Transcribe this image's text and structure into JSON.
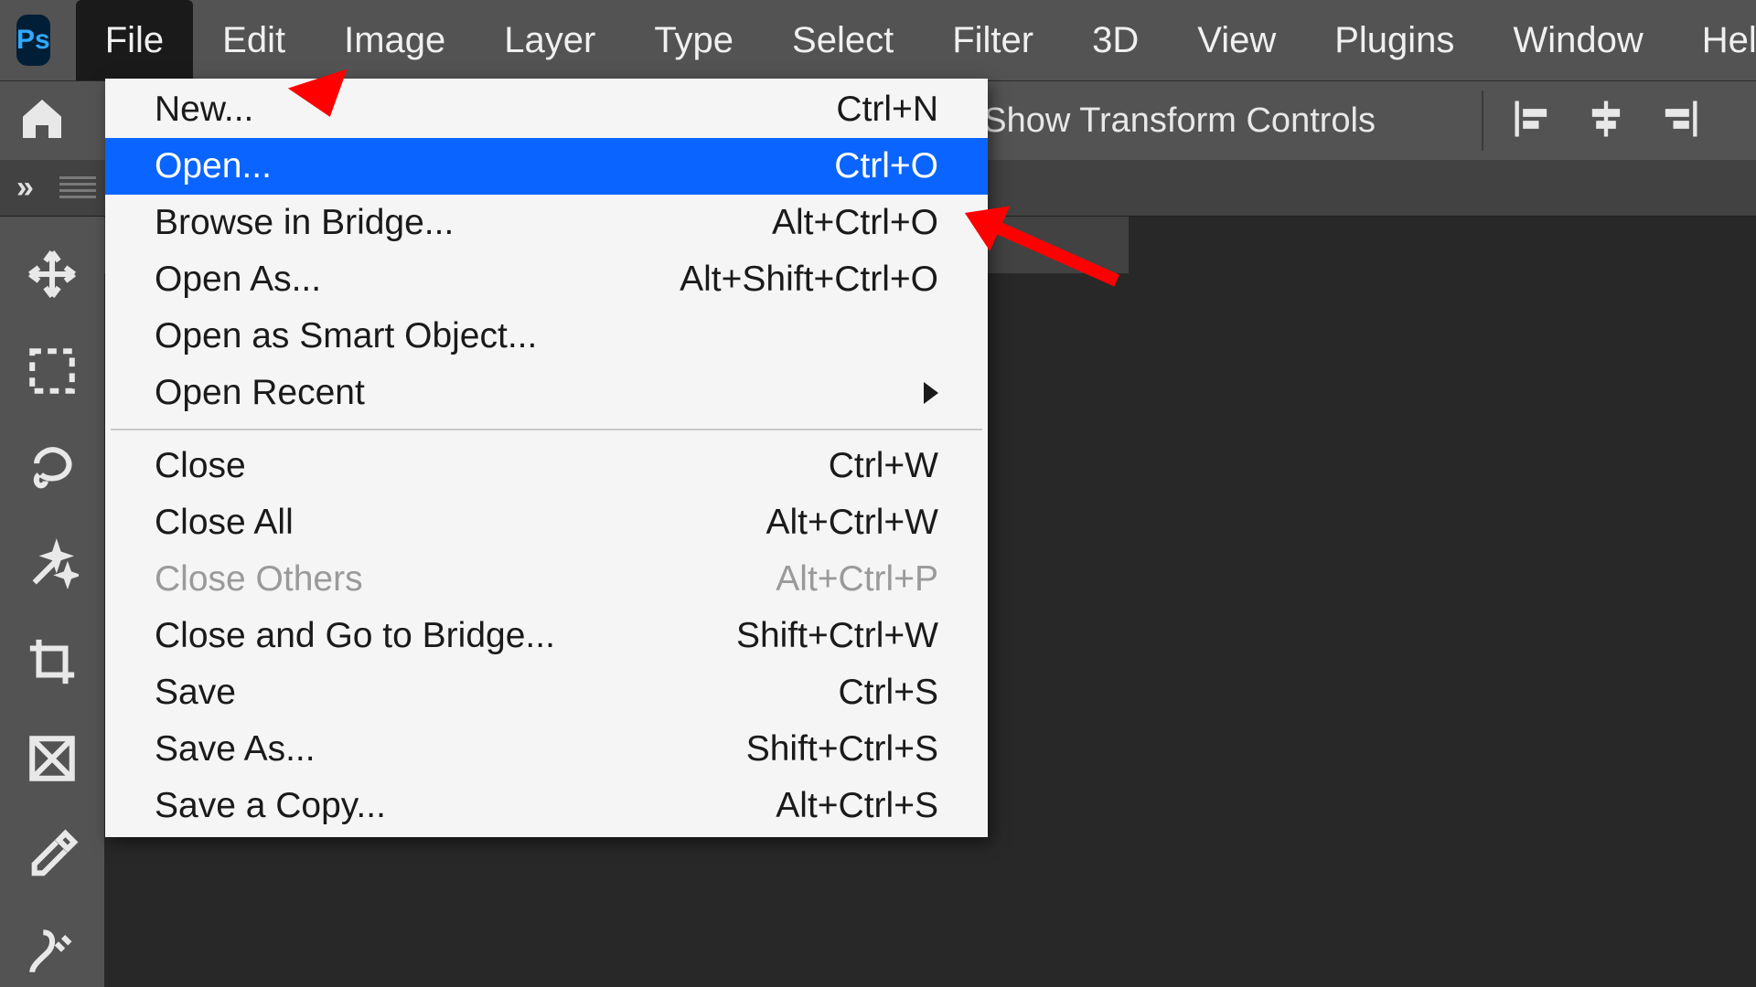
{
  "app": {
    "logo_text": "Ps"
  },
  "menubar": {
    "items": [
      "File",
      "Edit",
      "Image",
      "Layer",
      "Type",
      "Select",
      "Filter",
      "3D",
      "View",
      "Plugins",
      "Window",
      "Help"
    ],
    "open_index": 0
  },
  "optionsbar": {
    "transform_label": "Show Transform Controls"
  },
  "dropdown": {
    "items": [
      {
        "label": "New...",
        "shortcut": "Ctrl+N"
      },
      {
        "label": "Open...",
        "shortcut": "Ctrl+O",
        "highlight": true
      },
      {
        "label": "Browse in Bridge...",
        "shortcut": "Alt+Ctrl+O"
      },
      {
        "label": "Open As...",
        "shortcut": "Alt+Shift+Ctrl+O"
      },
      {
        "label": "Open as Smart Object...",
        "shortcut": ""
      },
      {
        "label": "Open Recent",
        "shortcut": "",
        "submenu": true
      },
      {
        "sep": true
      },
      {
        "label": "Close",
        "shortcut": "Ctrl+W"
      },
      {
        "label": "Close All",
        "shortcut": "Alt+Ctrl+W"
      },
      {
        "label": "Close Others",
        "shortcut": "Alt+Ctrl+P",
        "disabled": true
      },
      {
        "label": "Close and Go to Bridge...",
        "shortcut": "Shift+Ctrl+W"
      },
      {
        "label": "Save",
        "shortcut": "Ctrl+S"
      },
      {
        "label": "Save As...",
        "shortcut": "Shift+Ctrl+S"
      },
      {
        "label": "Save a Copy...",
        "shortcut": "Alt+Ctrl+S"
      }
    ]
  },
  "tools": [
    "move",
    "marquee",
    "lasso",
    "magic-wand",
    "crop",
    "frame",
    "eyedropper",
    "healing-brush"
  ]
}
